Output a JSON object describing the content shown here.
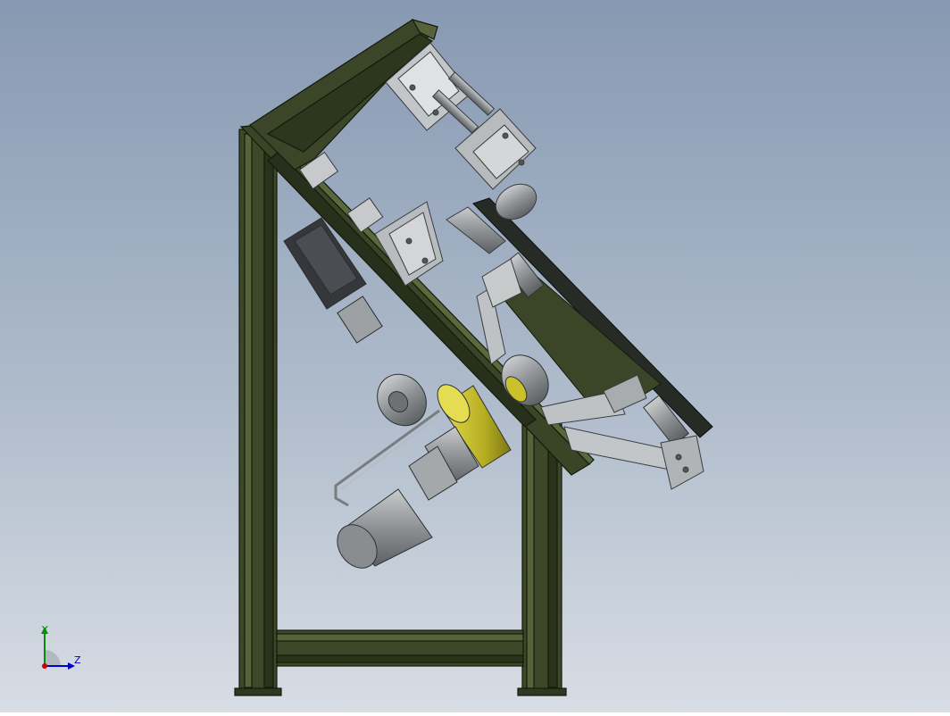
{
  "viewport": {
    "background_top": "#8a9cb4",
    "background_bottom": "#d6dbe3"
  },
  "colors": {
    "frame_green": "#3b4628",
    "frame_green_light": "#55623a",
    "frame_green_dark": "#1d2412",
    "steel": "#b9bcbe",
    "steel_dark": "#7c8084",
    "motor_grey": "#8d9093",
    "yellow_ring": "#c9c22a",
    "belt_black": "#2a2f2a"
  },
  "triad": {
    "y_label": "Y",
    "z_label": "Z",
    "y_color": "#0a8a0a",
    "z_color": "#0000cc",
    "x_color": "#cc0000"
  }
}
